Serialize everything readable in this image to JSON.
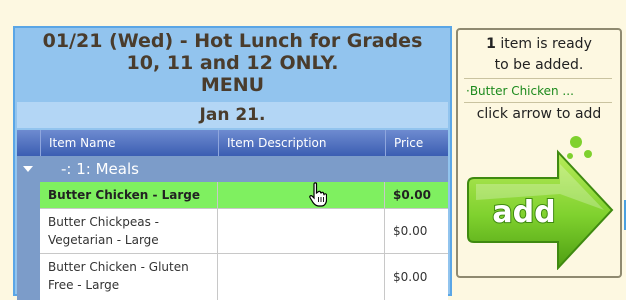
{
  "menu": {
    "title_lines": [
      "01/21 (Wed) - Hot Lunch for Grades",
      "10, 11 and 12 ONLY.",
      "MENU"
    ],
    "date_label": "Jan 21.",
    "columns": {
      "item_name": "Item Name",
      "item_description": "Item Description",
      "price": "Price"
    },
    "group": {
      "label": "-: 1: Meals"
    },
    "rows": [
      {
        "name": "Butter Chicken - Large",
        "description": "",
        "price": "$0.00",
        "selected": true
      },
      {
        "name": "Butter Chickpeas - Vegetarian - Large",
        "description": "",
        "price": "$0.00",
        "selected": false
      },
      {
        "name": "Butter Chicken - Gluten Free - Large",
        "description": "",
        "price": "$0.00",
        "selected": false
      }
    ]
  },
  "cart": {
    "count": "1",
    "ready_text": " item is ready",
    "ready_text2": "to be added.",
    "item_preview": "·Butter Chicken ...",
    "instruction": "click arrow to add",
    "add_label": "add"
  },
  "colors": {
    "accent_green": "#7ff060",
    "header_blue": "#3b5eb2",
    "title_brown": "#4a3c2c"
  },
  "icons": [
    "collapse-caret-icon",
    "hand-pointer-cursor-icon",
    "add-arrow-icon"
  ]
}
